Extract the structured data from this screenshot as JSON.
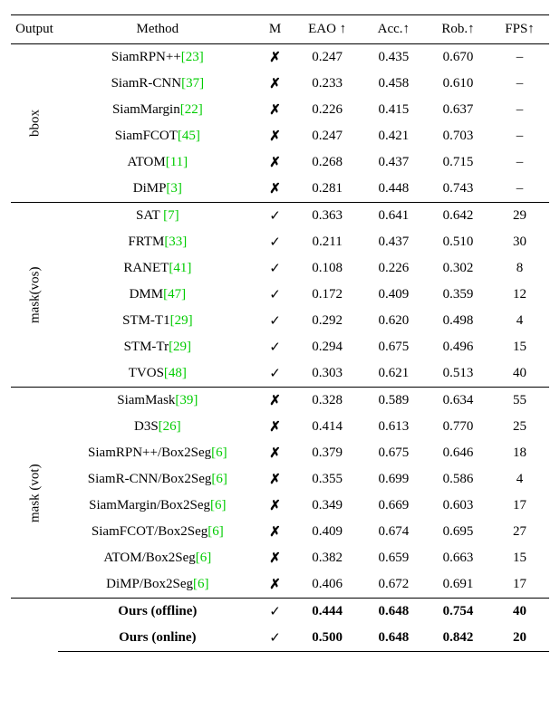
{
  "headers": {
    "output": "Output",
    "method": "Method",
    "m": "M",
    "eao": "EAO ↑",
    "acc": "Acc.↑",
    "rob": "Rob.↑",
    "fps": "FPS↑"
  },
  "groups": [
    {
      "label": "bbox",
      "rows": [
        {
          "method": "SiamRPN++",
          "ref": "[23]",
          "m": "✗",
          "eao": "0.247",
          "acc": "0.435",
          "rob": "0.670",
          "fps": "–"
        },
        {
          "method": "SiamR-CNN",
          "ref": "[37]",
          "m": "✗",
          "eao": "0.233",
          "acc": "0.458",
          "rob": "0.610",
          "fps": "–"
        },
        {
          "method": "SiamMargin",
          "ref": "[22]",
          "m": "✗",
          "eao": "0.226",
          "acc": "0.415",
          "rob": "0.637",
          "fps": "–"
        },
        {
          "method": "SiamFCOT",
          "ref": "[45]",
          "m": "✗",
          "eao": "0.247",
          "acc": "0.421",
          "rob": "0.703",
          "fps": "–"
        },
        {
          "method": "ATOM",
          "ref": "[11]",
          "m": "✗",
          "eao": "0.268",
          "acc": "0.437",
          "rob": "0.715",
          "fps": "–"
        },
        {
          "method": "DiMP",
          "ref": "[3]",
          "m": "✗",
          "eao": "0.281",
          "acc": "0.448",
          "rob": "0.743",
          "fps": "–"
        }
      ]
    },
    {
      "label": "mask(vos)",
      "rows": [
        {
          "method": "SAT",
          "ref": " [7]",
          "m": "✓",
          "eao": "0.363",
          "acc": "0.641",
          "rob": "0.642",
          "fps": "29"
        },
        {
          "method": "FRTM",
          "ref": "[33]",
          "m": "✓",
          "eao": "0.211",
          "acc": "0.437",
          "rob": "0.510",
          "fps": "30"
        },
        {
          "method": "RANET",
          "ref": "[41]",
          "m": "✓",
          "eao": "0.108",
          "acc": "0.226",
          "rob": "0.302",
          "fps": "8"
        },
        {
          "method": "DMM",
          "ref": "[47]",
          "m": "✓",
          "eao": "0.172",
          "acc": "0.409",
          "rob": "0.359",
          "fps": "12"
        },
        {
          "method": "STM-T1",
          "ref": "[29]",
          "m": "✓",
          "eao": "0.292",
          "acc": "0.620",
          "rob": "0.498",
          "fps": "4"
        },
        {
          "method": "STM-Tr",
          "ref": "[29]",
          "m": "✓",
          "eao": "0.294",
          "acc": "0.675",
          "rob": "0.496",
          "fps": "15"
        },
        {
          "method": "TVOS",
          "ref": "[48]",
          "m": "✓",
          "eao": "0.303",
          "acc": "0.621",
          "rob": "0.513",
          "fps": "40"
        }
      ]
    },
    {
      "label": "mask (vot)",
      "rows": [
        {
          "method": "SiamMask",
          "ref": "[39]",
          "m": "✗",
          "eao": "0.328",
          "acc": "0.589",
          "rob": "0.634",
          "fps": "55"
        },
        {
          "method": "D3S",
          "ref": "[26]",
          "m": "✗",
          "eao": "0.414",
          "acc": "0.613",
          "rob": "0.770",
          "fps": "25"
        },
        {
          "method": "SiamRPN++/Box2Seg",
          "ref": "[6]",
          "m": "✗",
          "eao": "0.379",
          "acc": "0.675",
          "rob": "0.646",
          "fps": "18"
        },
        {
          "method": "SiamR-CNN/Box2Seg",
          "ref": "[6]",
          "m": "✗",
          "eao": "0.355",
          "acc": "0.699",
          "rob": "0.586",
          "fps": "4"
        },
        {
          "method": "SiamMargin/Box2Seg",
          "ref": "[6]",
          "m": "✗",
          "eao": "0.349",
          "acc": "0.669",
          "rob": "0.603",
          "fps": "17"
        },
        {
          "method": "SiamFCOT/Box2Seg",
          "ref": "[6]",
          "m": "✗",
          "eao": "0.409",
          "acc": "0.674",
          "rob": "0.695",
          "fps": "27"
        },
        {
          "method": "ATOM/Box2Seg",
          "ref": "[6]",
          "m": "✗",
          "eao": "0.382",
          "acc": "0.659",
          "rob": "0.663",
          "fps": "15"
        },
        {
          "method": "DiMP/Box2Seg",
          "ref": "[6]",
          "m": "✗",
          "eao": "0.406",
          "acc": "0.672",
          "rob": "0.691",
          "fps": "17"
        }
      ]
    },
    {
      "label": "",
      "rows": [
        {
          "method": "Ours (offline)",
          "ref": "",
          "m": "✓",
          "eao": "0.444",
          "acc": "0.648",
          "rob": "0.754",
          "fps": "40",
          "bold": true
        },
        {
          "method": "Ours (online)",
          "ref": "",
          "m": "✓",
          "eao": "0.500",
          "acc": "0.648",
          "rob": "0.842",
          "fps": "20",
          "bold": true
        }
      ]
    }
  ],
  "chart_data": {
    "type": "table",
    "title": "Tracking benchmark comparison",
    "columns": [
      "Output",
      "Method",
      "M",
      "EAO",
      "Acc.",
      "Rob.",
      "FPS"
    ],
    "sections": [
      {
        "output": "bbox",
        "methods": [
          "SiamRPN++",
          "SiamR-CNN",
          "SiamMargin",
          "SiamFCOT",
          "ATOM",
          "DiMP"
        ]
      },
      {
        "output": "mask(vos)",
        "methods": [
          "SAT",
          "FRTM",
          "RANET",
          "DMM",
          "STM-T1",
          "STM-Tr",
          "TVOS"
        ]
      },
      {
        "output": "mask (vot)",
        "methods": [
          "SiamMask",
          "D3S",
          "SiamRPN++/Box2Seg",
          "SiamR-CNN/Box2Seg",
          "SiamMargin/Box2Seg",
          "SiamFCOT/Box2Seg",
          "ATOM/Box2Seg",
          "DiMP/Box2Seg"
        ]
      },
      {
        "output": "",
        "methods": [
          "Ours (offline)",
          "Ours (online)"
        ]
      }
    ]
  }
}
